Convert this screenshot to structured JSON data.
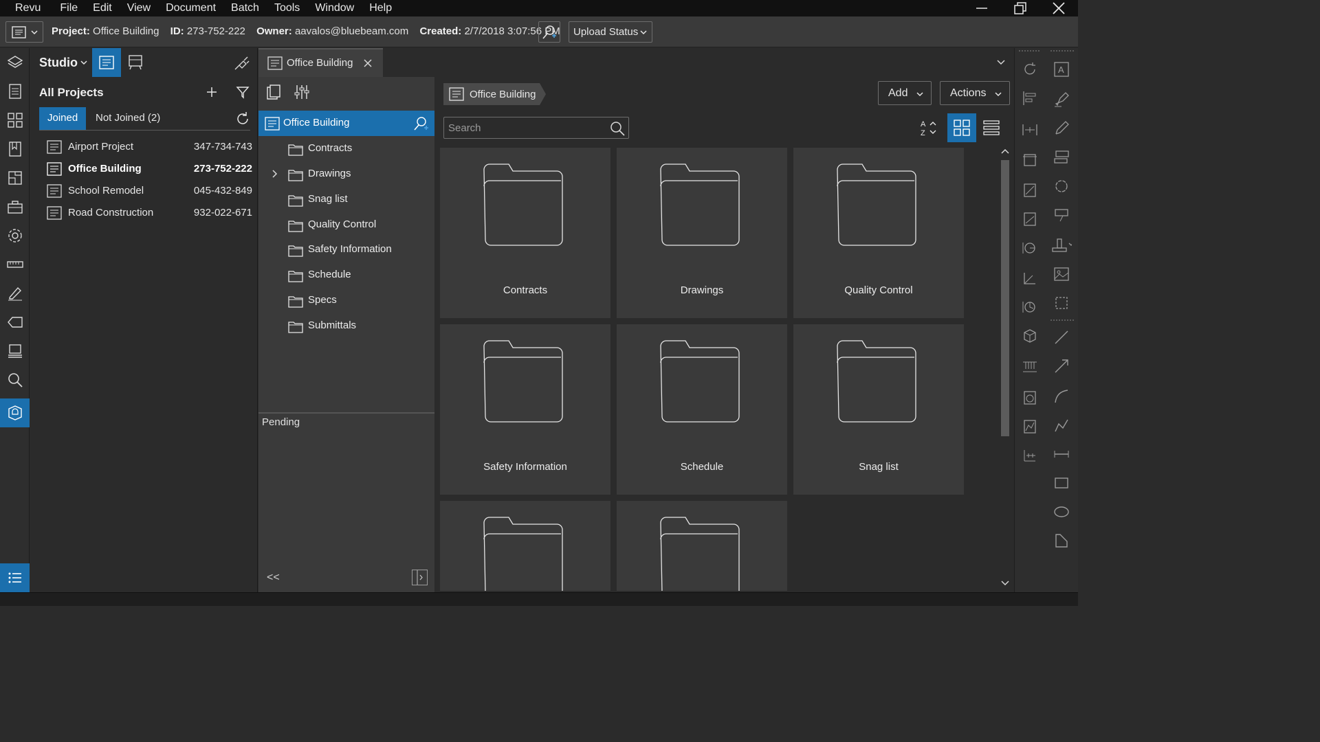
{
  "menu": [
    "Revu",
    "File",
    "Edit",
    "View",
    "Document",
    "Batch",
    "Tools",
    "Window",
    "Help"
  ],
  "project_bar": {
    "project_label": "Project:",
    "project_value": "Office Building",
    "id_label": "ID:",
    "id_value": "273-752-222",
    "owner_label": "Owner:",
    "owner_value": "aavalos@bluebeam.com",
    "created_label": "Created:",
    "created_value": "2/7/2018 3:07:56 PM",
    "upload_status": "Upload Status"
  },
  "studio": {
    "title": "Studio",
    "all_projects": "All Projects",
    "tabs": {
      "joined": "Joined",
      "not_joined": "Not Joined (2)"
    },
    "projects": [
      {
        "name": "Airport Project",
        "id": "347-734-743",
        "selected": false
      },
      {
        "name": "Office Building",
        "id": "273-752-222",
        "selected": true
      },
      {
        "name": "School Remodel",
        "id": "045-432-849",
        "selected": false
      },
      {
        "name": "Road Construction",
        "id": "932-022-671",
        "selected": false
      }
    ]
  },
  "doc_tab": {
    "title": "Office Building"
  },
  "tree": {
    "root": "Office Building",
    "folders": [
      "Contracts",
      "Drawings",
      "Snag list",
      "Quality Control",
      "Safety Information",
      "Schedule",
      "Specs",
      "Submittals"
    ],
    "pending": "Pending",
    "collapse": "<<"
  },
  "main": {
    "breadcrumb": "Office Building",
    "add_label": "Add",
    "actions_label": "Actions",
    "search_placeholder": "Search",
    "folders": [
      "Contracts",
      "Drawings",
      "Quality Control",
      "Safety Information",
      "Schedule",
      "Snag list",
      "",
      ""
    ]
  },
  "colors": {
    "accent": "#1b6fad",
    "menubar": "#111111",
    "panel": "#2b2b2b",
    "card": "#3a3a3a"
  }
}
